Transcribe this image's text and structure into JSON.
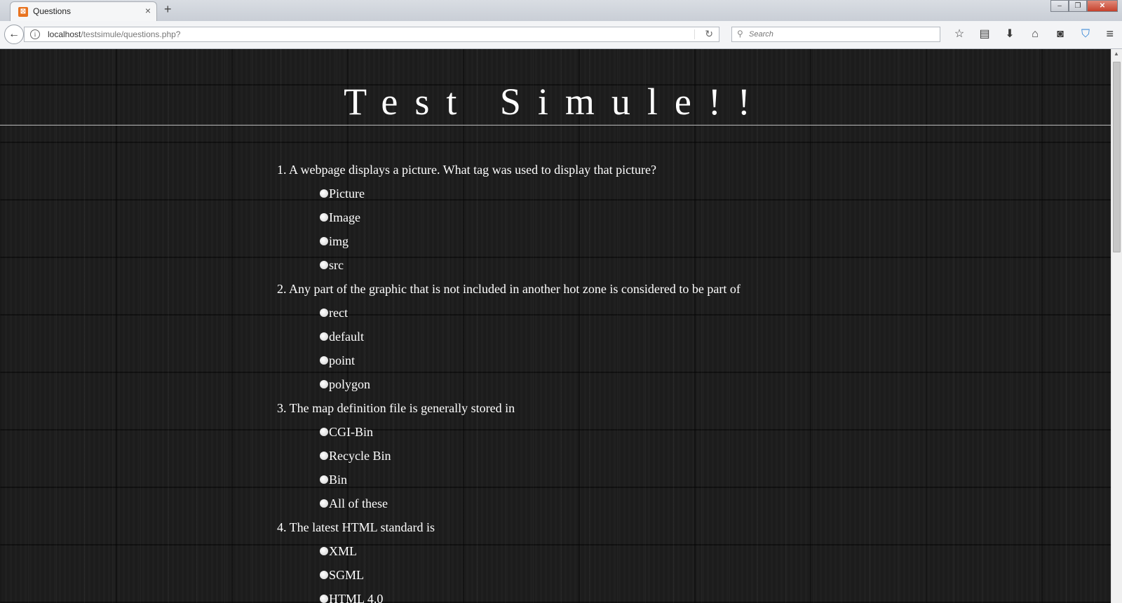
{
  "browser": {
    "tab_title": "Questions",
    "tab_close": "×",
    "new_tab": "+",
    "url_host": "localhost",
    "url_path": "/testsimule/questions.php?",
    "search_placeholder": "Search",
    "window_controls": {
      "minimize": "–",
      "maximize": "❐",
      "close": "✕"
    }
  },
  "page": {
    "title": "Test Simule!!",
    "questions": [
      {
        "text": "1. A webpage displays a picture. What tag was used to display that picture?",
        "options": [
          "Picture",
          "Image",
          "img",
          "src"
        ]
      },
      {
        "text": "2. Any part of the graphic that is not included in another hot zone is considered to be part of",
        "options": [
          "rect",
          "default",
          "point",
          "polygon"
        ]
      },
      {
        "text": "3. The map definition file is generally stored in",
        "options": [
          "CGI-Bin",
          "Recycle Bin",
          "Bin",
          "All of these"
        ]
      },
      {
        "text": "4. The latest HTML standard is",
        "options": [
          "XML",
          "SGML",
          "HTML 4.0"
        ]
      }
    ]
  },
  "icons": {
    "back": "back-arrow-icon",
    "info": "info-icon",
    "reload": "reload-icon",
    "search": "search-icon",
    "bookmark": "star-icon",
    "reading_list": "reading-list-icon",
    "download": "download-icon",
    "home": "home-icon",
    "pocket": "pocket-icon",
    "shield": "shield-icon",
    "menu": "hamburger-menu-icon"
  },
  "colors": {
    "tab_favicon": "#e8731f",
    "page_background": "#1c1c1c",
    "text": "#ffffff",
    "shield": "#2a7fd4"
  }
}
